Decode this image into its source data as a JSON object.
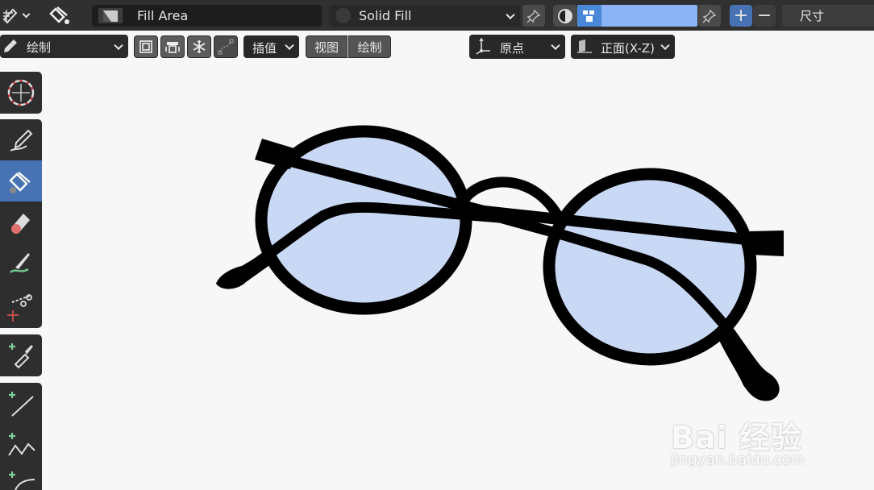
{
  "header": {
    "material_name": "Fill Area",
    "fill_style": "Solid Fill",
    "size_label": "尺寸",
    "color_swatch": "#8cb4f5"
  },
  "toolbar": {
    "mode": "绘制",
    "interpolate_label": "插值",
    "view_label": "视图",
    "draw_label": "绘制",
    "origin_label": "原点",
    "plane_label": "正面(X-Z)"
  },
  "tools": [
    {
      "name": "cursor-tool",
      "icon": "crosshair-icon"
    },
    {
      "name": "draw-tool",
      "icon": "pencil-icon"
    },
    {
      "name": "fill-tool",
      "icon": "paint-bucket-icon",
      "active": true
    },
    {
      "name": "erase-tool",
      "icon": "eraser-icon"
    },
    {
      "name": "tint-tool",
      "icon": "brush-icon"
    },
    {
      "name": "cutter-tool",
      "icon": "scissors-icon"
    },
    {
      "name": "eyedropper-tool",
      "icon": "eyedropper-icon"
    },
    {
      "name": "line-tool",
      "icon": "line-icon"
    },
    {
      "name": "polyline-tool",
      "icon": "polyline-icon"
    },
    {
      "name": "arc-tool",
      "icon": "arc-icon"
    }
  ],
  "canvas": {
    "lens_fill": "#c9d9f5",
    "stroke_color": "#000000"
  },
  "watermark": {
    "brand": "Bai 经验",
    "url": "jingyan.baidu.com"
  }
}
